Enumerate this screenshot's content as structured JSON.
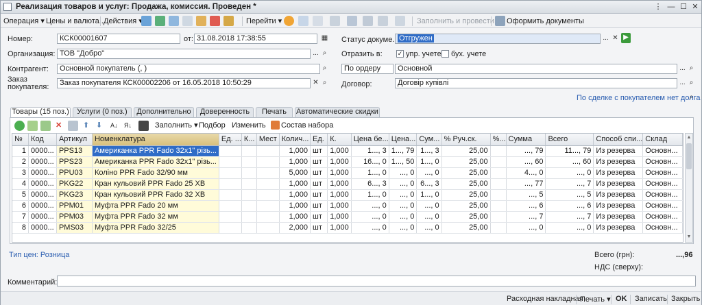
{
  "window": {
    "title": "Реализация товаров и услуг: Продажа, комиссия. Проведен *",
    "controls": [
      "⋮",
      "—",
      "☐",
      "✕"
    ]
  },
  "toolbar": {
    "operation": "Операция",
    "prices": "Цены и валюта...",
    "actions": "Действия",
    "goto": "Перейти",
    "fill_post": "Заполнить и провести",
    "make_docs": "Оформить документы"
  },
  "form": {
    "number_label": "Номер:",
    "number": "КСК00001607",
    "date_label": "от:",
    "date": "31.08.2018 17:38:55",
    "status_label": "Статус докуме...",
    "status": "Отгружен",
    "org_label": "Организация:",
    "org": "ТОВ \"Добро\"",
    "reflect_label": "Отразить в:",
    "mgmt_label": "упр. учете",
    "mgmt_checked": "✓",
    "acct_label": "бух. учете",
    "contractor_label": "Контрагент:",
    "contractor": "Основной покупатель (,           )",
    "settle_mode": "По ордеру",
    "settle_acc": "Основной",
    "order_label": "Заказ\nпокупателя:",
    "order": "Заказ покупателя КСК00002206 от 16.05.2018 10:50:29",
    "contract_label": "Договор:",
    "contract": "Договір купівлі",
    "debt_link": "По сделке с покупателем нет долга"
  },
  "tabs": [
    {
      "label": "Товары (15 поз.)",
      "active": true
    },
    {
      "label": "Услуги (0 поз.)"
    },
    {
      "label": "Дополнительно"
    },
    {
      "label": "Доверенность"
    },
    {
      "label": "Печать"
    },
    {
      "label": "Автоматические скидки"
    }
  ],
  "gridbar": {
    "fill": "Заполнить",
    "select": "Подбор",
    "change": "Изменить",
    "kit": "Состав набора"
  },
  "table": {
    "columns": [
      "№",
      "Код",
      "Артикул",
      "Номенклатура",
      "Ед. ...",
      "К...",
      "Мест",
      "Колич...",
      "Ед.",
      "К.",
      "Цена бе...",
      "Цена...",
      "Сум...",
      "% Руч.ск.",
      "%...",
      "Сумма",
      "Всего",
      "Способ спи...",
      "Склад"
    ],
    "rows": [
      [
        "1",
        "0000...",
        "PPS13",
        "Американка PPR Fado 32x1\" різь...",
        "",
        "",
        "",
        "1,000",
        "шт",
        "1,000",
        "1..., 3",
        "1..., 79",
        "1..., 3",
        "25,00",
        "",
        "..., 79",
        "11..., 79",
        "Из резерва",
        "Основн..."
      ],
      [
        "2",
        "0000...",
        "PPS23",
        "Американка PPR Fado 32x1\" різь...",
        "",
        "",
        "",
        "1,000",
        "шт",
        "1,000",
        "16..., 0",
        "1..., 50",
        "1..., 0",
        "25,00",
        "",
        "..., 60",
        "..., 60",
        "Из резерва",
        "Основн..."
      ],
      [
        "3",
        "0000...",
        "PPU03",
        "Коліно PPR Fado 32/90 мм",
        "",
        "",
        "",
        "5,000",
        "шт",
        "1,000",
        "1..., 0",
        "..., 0",
        "..., 0",
        "25,00",
        "",
        "4..., 0",
        "..., 0",
        "Из резерва",
        "Основн..."
      ],
      [
        "4",
        "0000...",
        "PKG22",
        "Кран кульовий PPR Fado 25 ХВ",
        "",
        "",
        "",
        "1,000",
        "шт",
        "1,000",
        "6..., 3",
        "..., 0",
        "6..., 3",
        "25,00",
        "",
        "..., 77",
        "..., 7",
        "Из резерва",
        "Основн..."
      ],
      [
        "5",
        "0000...",
        "PKG23",
        "Кран кульовий PPR Fado 32 ХВ",
        "",
        "",
        "",
        "1,000",
        "шт",
        "1,000",
        "1..., 0",
        "..., 0",
        "1..., 0",
        "25,00",
        "",
        "..., 5",
        "..., 5",
        "Из резерва",
        "Основн..."
      ],
      [
        "6",
        "0000...",
        "PPM01",
        "Муфта PPR Fado 20 мм",
        "",
        "",
        "",
        "1,000",
        "шт",
        "1,000",
        "..., 0",
        "..., 0",
        "..., 0",
        "25,00",
        "",
        "..., 6",
        "..., 6",
        "Из резерва",
        "Основн..."
      ],
      [
        "7",
        "0000...",
        "PPM03",
        "Муфта PPR Fado 32 мм",
        "",
        "",
        "",
        "1,000",
        "шт",
        "1,000",
        "..., 0",
        "..., 0",
        "..., 0",
        "25,00",
        "",
        "..., 7",
        "..., 7",
        "Из резерва",
        "Основн..."
      ],
      [
        "8",
        "0000...",
        "PMS03",
        "Муфта PPR Fado 32/25",
        "",
        "",
        "",
        "2,000",
        "шт",
        "1,000",
        "..., 0",
        "..., 0",
        "..., 0",
        "25,00",
        "",
        "..., 0",
        "..., 0",
        "Из резерва",
        "Основн..."
      ]
    ]
  },
  "totals": {
    "price_type": "Тип цен: Розница",
    "total_label": "Всего (грн):",
    "total_value": "...,96",
    "vat_label": "НДС (сверху):"
  },
  "comment": {
    "label": "Комментарий:",
    "value": ""
  },
  "footer": {
    "waybill": "Расходная накладная",
    "print": "Печать",
    "ok": "OK",
    "save": "Записать",
    "close": "Закрыть"
  },
  "colors": {
    "selected_row": "#2f6cc7",
    "highlight_col": "#fffbd9",
    "link": "#2a5db0"
  }
}
